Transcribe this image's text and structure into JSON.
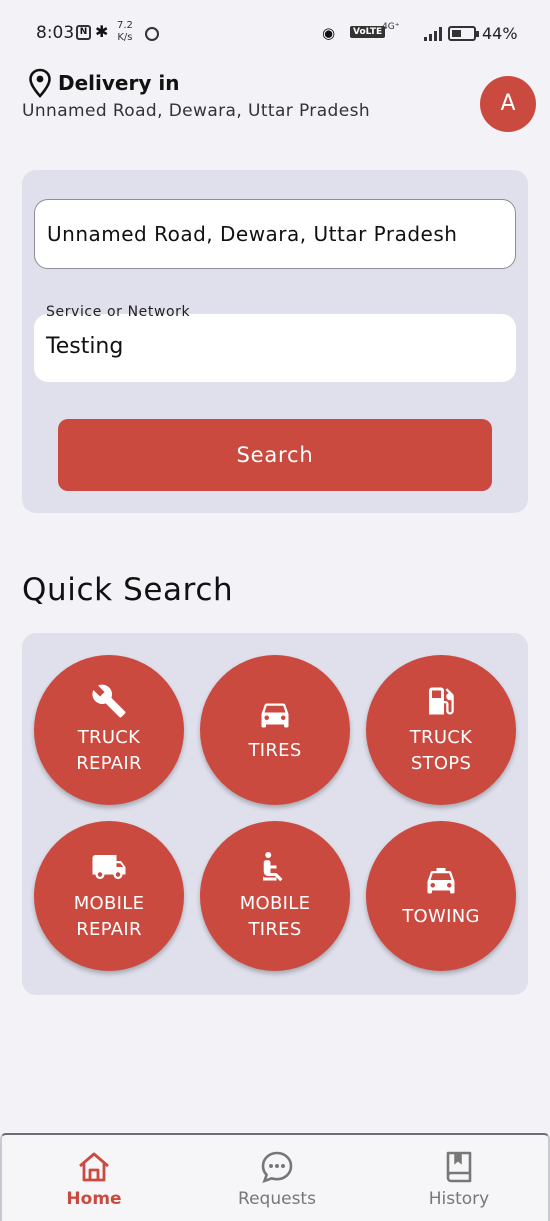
{
  "status": {
    "time": "8:03",
    "nfc": "N",
    "speed_value": "7.2",
    "speed_unit": "K/s",
    "volte": "VoLTE",
    "network": "4G⁺",
    "battery": "44%",
    "battery_fraction": 0.44
  },
  "header": {
    "delivery_title": "Delivery in",
    "delivery_address": "Unnamed Road, Dewara, Uttar Pradesh",
    "avatar_letter": "A"
  },
  "search": {
    "address_value": "Unnamed Road, Dewara, Uttar Pradesh",
    "service_label": "Service or Network",
    "service_value": "Testing",
    "button_label": "Search"
  },
  "quick_search": {
    "title": "Quick Search",
    "items": [
      {
        "label": "TRUCK\nREPAIR",
        "icon": "wrench-icon"
      },
      {
        "label": "TIRES",
        "icon": "car-icon"
      },
      {
        "label": "TRUCK\nSTOPS",
        "icon": "fuel-pump-icon"
      },
      {
        "label": "MOBILE\nREPAIR",
        "icon": "truck-icon"
      },
      {
        "label": "MOBILE\nTIRES",
        "icon": "person-seated-icon"
      },
      {
        "label": "TOWING",
        "icon": "taxi-icon"
      }
    ]
  },
  "nav": {
    "items": [
      {
        "label": "Home",
        "icon": "home-icon",
        "active": true
      },
      {
        "label": "Requests",
        "icon": "chat-bubble-icon",
        "active": false
      },
      {
        "label": "History",
        "icon": "book-icon",
        "active": false
      }
    ]
  },
  "colors": {
    "accent": "#cb4a40",
    "panel": "#dfe0ec",
    "background": "#f2f2f7"
  }
}
